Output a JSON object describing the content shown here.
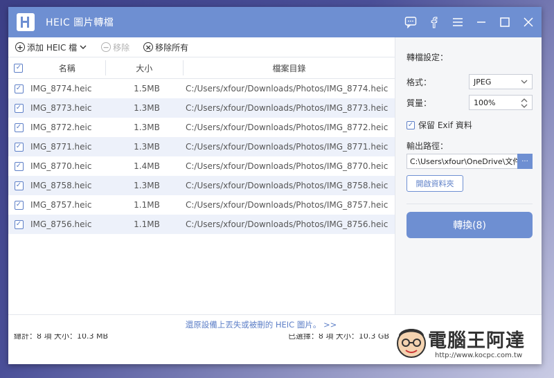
{
  "app": {
    "title": "HEIC 圖片轉檔"
  },
  "titlebar_icons": [
    "feedback-icon",
    "facebook-icon",
    "menu-icon",
    "minimize-icon",
    "maximize-icon",
    "close-icon"
  ],
  "toolbar": {
    "add_label": "添加 HEIC 檔",
    "remove_label": "移除",
    "remove_all_label": "移除所有"
  },
  "table": {
    "headers": {
      "name": "名稱",
      "size": "大小",
      "path": "檔案目錄"
    },
    "rows": [
      {
        "name": "IMG_8774.heic",
        "size": "1.5MB",
        "path": "C:/Users/xfour/Downloads/Photos/IMG_8774.heic"
      },
      {
        "name": "IMG_8773.heic",
        "size": "1.3MB",
        "path": "C:/Users/xfour/Downloads/Photos/IMG_8773.heic"
      },
      {
        "name": "IMG_8772.heic",
        "size": "1.3MB",
        "path": "C:/Users/xfour/Downloads/Photos/IMG_8772.heic"
      },
      {
        "name": "IMG_8771.heic",
        "size": "1.3MB",
        "path": "C:/Users/xfour/Downloads/Photos/IMG_8771.heic"
      },
      {
        "name": "IMG_8770.heic",
        "size": "1.4MB",
        "path": "C:/Users/xfour/Downloads/Photos/IMG_8770.heic"
      },
      {
        "name": "IMG_8758.heic",
        "size": "1.3MB",
        "path": "C:/Users/xfour/Downloads/Photos/IMG_8758.heic"
      },
      {
        "name": "IMG_8757.heic",
        "size": "1.1MB",
        "path": "C:/Users/xfour/Downloads/Photos/IMG_8757.heic"
      },
      {
        "name": "IMG_8756.heic",
        "size": "1.1MB",
        "path": "C:/Users/xfour/Downloads/Photos/IMG_8756.heic"
      }
    ]
  },
  "footer": {
    "total": "總計：8 項 大小：10.3 MB",
    "selected": "已選擇：8 項 大小：10.3 GB",
    "recover_link": "還原設備上丟失或被刪的 HEIC 圖片。 >>"
  },
  "settings": {
    "title": "轉檔設定：",
    "format_label": "格式：",
    "format_value": "JPEG",
    "quality_label": "質量：",
    "quality_value": "100%",
    "exif_label": "保留 Exif 資料",
    "output_label": "輸出路徑：",
    "output_path": "C:\\Users\\xfour\\OneDrive\\文件",
    "browse_label": "···",
    "open_folder_label": "開啟資料夾",
    "convert_label": "轉換(8)"
  },
  "watermark": {
    "text": "電腦王阿達",
    "url": "http://www.kocpc.com.tw"
  },
  "colors": {
    "accent": "#6e8fd2",
    "link": "#5d7fc7",
    "row_alt": "#edf1fa"
  }
}
